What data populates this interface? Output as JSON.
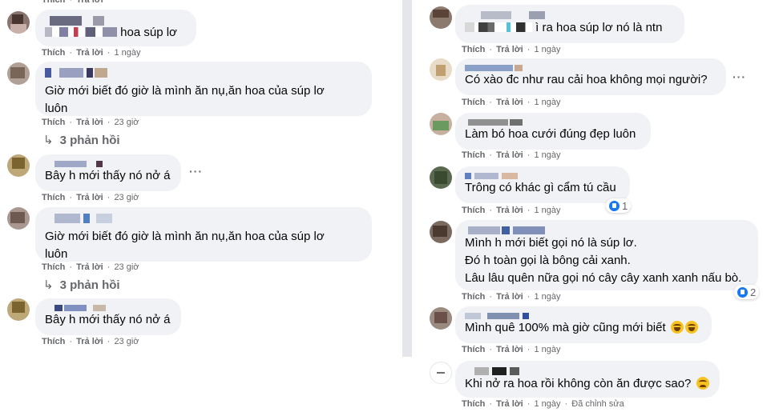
{
  "actions": {
    "like": "Thích",
    "reply": "Trả lời",
    "dot": "·",
    "edited": "Đã chỉnh sửa"
  },
  "left": {
    "c1": {
      "text": "hoa súp lơ",
      "time": "1 ngày"
    },
    "c2": {
      "text": "Giờ mới biết đó giờ là mình ăn nụ,ăn hoa của súp lơ luôn",
      "time": "23 giờ",
      "replies": "3 phản hồi"
    },
    "c3": {
      "text": "Bây h mới thấy nó nở á",
      "time": "23 giờ"
    },
    "c4": {
      "text": "Giờ mới biết đó giờ là mình ăn nụ,ăn hoa của súp lơ luôn",
      "time": "23 giờ",
      "replies": "3 phản hồi"
    },
    "c5": {
      "text": "Bây h mới thấy nó nở á",
      "time": "23 giờ"
    }
  },
  "right": {
    "r1": {
      "text": "ì ra hoa súp lơ nó là ntn",
      "time": "1 ngày"
    },
    "r2": {
      "text": "Có xào đc như rau cải hoa không mọi người?",
      "time": "1 ngày"
    },
    "r3": {
      "text": "Làm bó hoa cưới đúng đẹp luôn",
      "time": "1 ngày"
    },
    "r4": {
      "text": "Trông có khác gì cẩm tú cầu",
      "time": "1 ngày",
      "reactions": "1"
    },
    "r5": {
      "line1": "Mình h mới biết gọi nó là súp lơ.",
      "line2": "Đó h toàn gọi là bông cải xanh.",
      "line3": "Lâu lâu quên nữa gọi nó cây cây xanh xanh nấu bò.",
      "time": "1 ngày",
      "reactions": "2"
    },
    "r6": {
      "text": "Mình quê 100% mà giờ cũng mới biết",
      "time": "1 ngày"
    },
    "r7": {
      "text": "Khi nở ra hoa rồi không còn ăn được sao?",
      "time": "1 ngày"
    }
  },
  "icons": {
    "more": "more-options-icon",
    "like": "like-reaction-icon",
    "laugh": "laughing-emoji-icon",
    "sad": "sad-emoji-icon",
    "reply_arrow": "reply-arrow-icon"
  },
  "colors": {
    "bubble": "#f0f2f5",
    "meta": "#65676b",
    "text": "#050505",
    "like": "#1877f2",
    "divider": "#e4e6eb"
  }
}
